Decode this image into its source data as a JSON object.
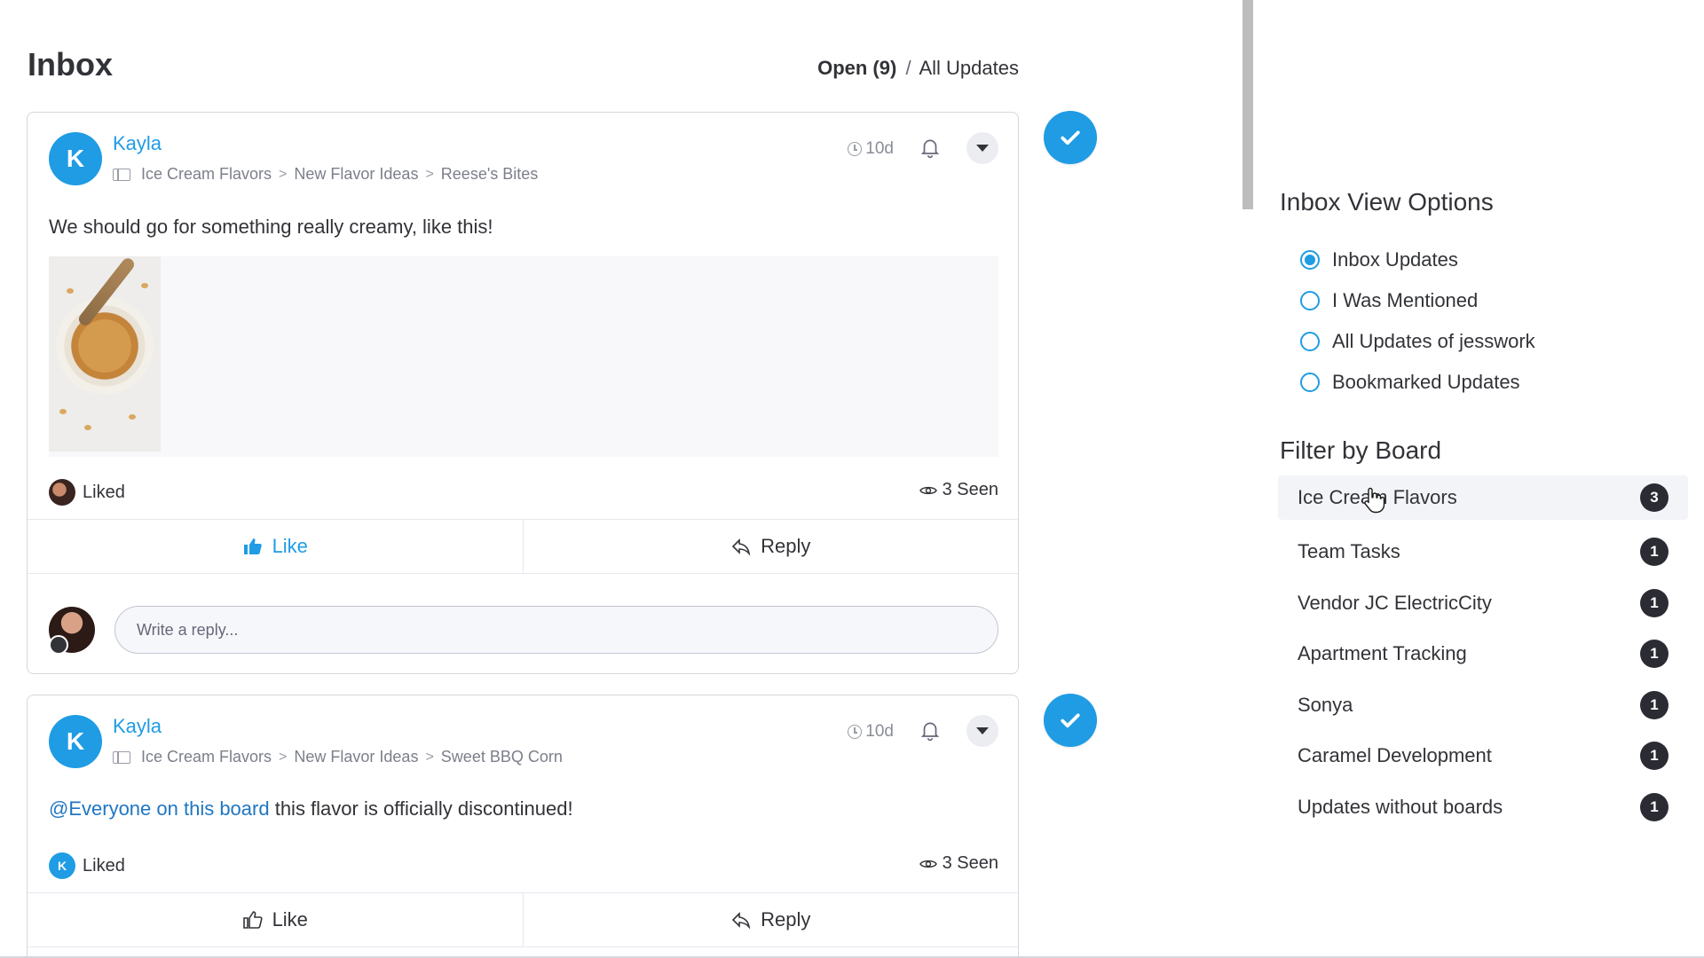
{
  "header": {
    "title": "Inbox",
    "open_label": "Open (9)",
    "separator": "/",
    "all_label": "All Updates"
  },
  "updates": [
    {
      "author": "Kayla",
      "avatar_initial": "K",
      "breadcrumb": [
        "Ice Cream Flavors",
        "New Flavor Ideas",
        "Reese's Bites"
      ],
      "breadcrumb_sep": ">",
      "time": "10d",
      "body": "We should go for something really creamy, like this!",
      "liked_label": "Liked",
      "seen_label": "3 Seen",
      "like_label": "Like",
      "reply_label": "Reply",
      "reply_placeholder": "Write a reply..."
    },
    {
      "author": "Kayla",
      "avatar_initial": "K",
      "breadcrumb": [
        "Ice Cream Flavors",
        "New Flavor Ideas",
        "Sweet BBQ Corn"
      ],
      "breadcrumb_sep": ">",
      "time": "10d",
      "mention": "@Everyone on this board",
      "body": " this flavor is officially discontinued!",
      "liker_initial": "K",
      "liked_label": "Liked",
      "seen_label": "3 Seen",
      "like_label": "Like",
      "reply_label": "Reply"
    }
  ],
  "panel": {
    "view_title": "Inbox View Options",
    "view_options": [
      {
        "label": "Inbox Updates",
        "selected": true
      },
      {
        "label": "I Was Mentioned",
        "selected": false
      },
      {
        "label": "All Updates of jesswork",
        "selected": false
      },
      {
        "label": "Bookmarked Updates",
        "selected": false
      }
    ],
    "filter_title": "Filter by Board",
    "boards": [
      {
        "label": "Ice Cream Flavors",
        "count": "3"
      },
      {
        "label": "Team Tasks",
        "count": "1"
      },
      {
        "label": "Vendor JC ElectricCity",
        "count": "1"
      },
      {
        "label": "Apartment Tracking",
        "count": "1"
      },
      {
        "label": "Sonya",
        "count": "1"
      },
      {
        "label": "Caramel Development",
        "count": "1"
      },
      {
        "label": "Updates without boards",
        "count": "1"
      }
    ]
  },
  "colors": {
    "accent": "#1f9ce4",
    "mention": "#1f76c2",
    "badge": "#2b2c33",
    "text": "#323338"
  },
  "icons": [
    "board-icon",
    "clock-icon",
    "bell-icon",
    "chevron-down-icon",
    "eye-icon",
    "thumbs-up-icon",
    "reply-icon",
    "check-icon",
    "home-icon",
    "hand-cursor-icon"
  ]
}
